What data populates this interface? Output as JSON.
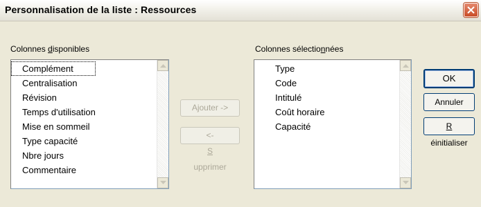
{
  "window": {
    "title": "Personnalisation de la liste : Ressources"
  },
  "available": {
    "label_before": "Colonnes ",
    "label_accel": "d",
    "label_after": "isponibles",
    "items": [
      "Complément",
      "Centralisation",
      "Révision",
      "Temps d'utilisation",
      "Mise en sommeil",
      "Type capacité",
      "Nbre jours",
      "Commentaire"
    ]
  },
  "selected": {
    "label_before": "Colonnes sélectio",
    "label_accel": "n",
    "label_after": "nées",
    "items": [
      "Type",
      "Code",
      "Intitulé",
      "Coût horaire",
      "Capacité"
    ]
  },
  "buttons": {
    "add_label": "Ajouter ->",
    "remove_before": "<- ",
    "remove_accel": "S",
    "remove_after": "upprimer",
    "ok_label": "OK",
    "cancel_label": "Annuler",
    "reset_accel": "R",
    "reset_after": "éinitialiser"
  },
  "colors": {
    "dialog_bg": "#ece9d8",
    "close_button": "#c94c27",
    "disabled_text": "#aca899"
  }
}
